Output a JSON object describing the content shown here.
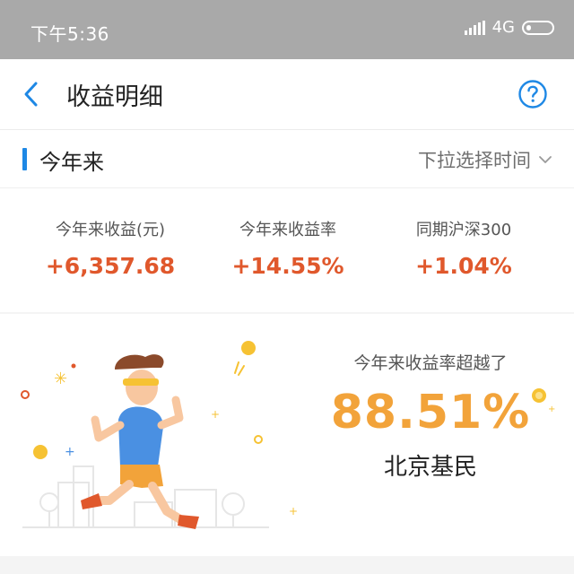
{
  "status_bar": {
    "time": "下午5:36",
    "network": "4G"
  },
  "header": {
    "title": "收益明细",
    "back_icon": "chevron-left-icon",
    "help_icon": "question-circle-icon"
  },
  "period": {
    "title": "今年来",
    "selector_label": "下拉选择时间"
  },
  "stats": [
    {
      "label": "今年来收益(元)",
      "value": "+6,357.68"
    },
    {
      "label": "今年来收益率",
      "value": "+14.55%"
    },
    {
      "label": "同期沪深300",
      "value": "+1.04%"
    }
  ],
  "rank": {
    "caption": "今年来收益率超越了",
    "percent": "88.51%",
    "group": "北京基民"
  },
  "colors": {
    "status_bar": "#a9a9a9",
    "accent_blue": "#1e88e5",
    "gain_red": "#e0582c",
    "rank_orange": "#f2a33a"
  }
}
